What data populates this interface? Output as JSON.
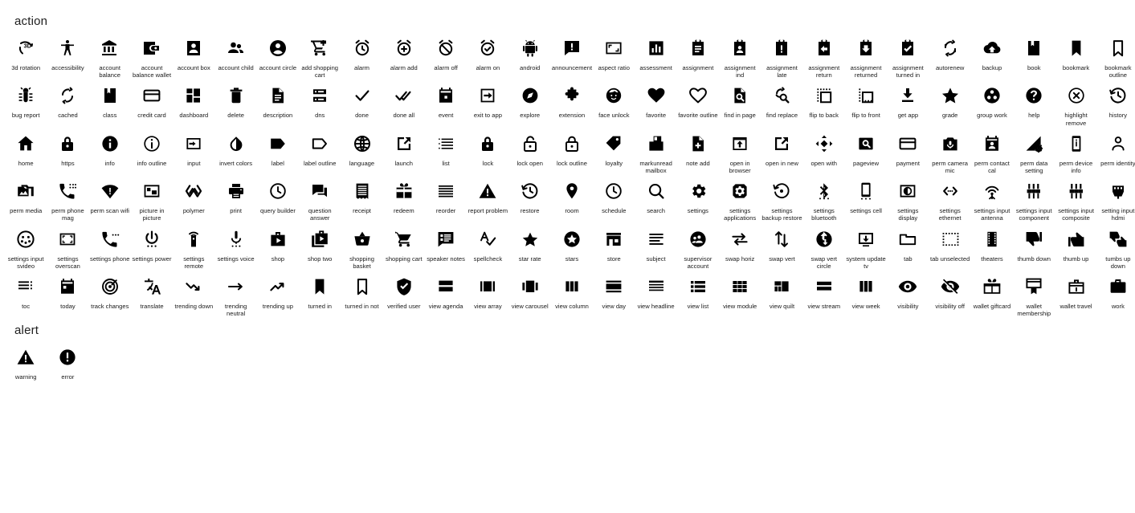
{
  "page": {
    "background": "#ffffff",
    "icon_color": "#000000",
    "label_color": "#1a1a1a"
  },
  "sections": [
    {
      "id": "action",
      "title": "action",
      "icons": [
        {
          "name": "3d-rotation-icon",
          "label": "3d rotation"
        },
        {
          "name": "accessibility-icon",
          "label": "accessibility"
        },
        {
          "name": "account-balance-icon",
          "label": "account balance"
        },
        {
          "name": "account-balance-wallet-icon",
          "label": "account balance wallet"
        },
        {
          "name": "account-box-icon",
          "label": "account box"
        },
        {
          "name": "account-child-icon",
          "label": "account child"
        },
        {
          "name": "account-circle-icon",
          "label": "account circle"
        },
        {
          "name": "add-shopping-cart-icon",
          "label": "add shopping cart"
        },
        {
          "name": "alarm-icon",
          "label": "alarm"
        },
        {
          "name": "alarm-add-icon",
          "label": "alarm add"
        },
        {
          "name": "alarm-off-icon",
          "label": "alarm off"
        },
        {
          "name": "alarm-on-icon",
          "label": "alarm on"
        },
        {
          "name": "android-icon",
          "label": "android"
        },
        {
          "name": "announcement-icon",
          "label": "announcement"
        },
        {
          "name": "aspect-ratio-icon",
          "label": "aspect ratio"
        },
        {
          "name": "assessment-icon",
          "label": "assessment"
        },
        {
          "name": "assignment-icon",
          "label": "assignment"
        },
        {
          "name": "assignment-ind-icon",
          "label": "assignment ind"
        },
        {
          "name": "assignment-late-icon",
          "label": "assignment late"
        },
        {
          "name": "assignment-return-icon",
          "label": "assignment return"
        },
        {
          "name": "assignment-returned-icon",
          "label": "assignment returned"
        },
        {
          "name": "assignment-turned-in-icon",
          "label": "assignment turned in"
        },
        {
          "name": "autorenew-icon",
          "label": "autorenew"
        },
        {
          "name": "backup-icon",
          "label": "backup"
        },
        {
          "name": "book-icon",
          "label": "book"
        },
        {
          "name": "bookmark-icon",
          "label": "bookmark"
        },
        {
          "name": "bookmark-outline-icon",
          "label": "bookmark outline"
        },
        {
          "name": "bug-report-icon",
          "label": "bug report"
        },
        {
          "name": "cached-icon",
          "label": "cached"
        },
        {
          "name": "class-icon",
          "label": "class"
        },
        {
          "name": "credit-card-icon",
          "label": "credit card"
        },
        {
          "name": "dashboard-icon",
          "label": "dashboard"
        },
        {
          "name": "delete-icon",
          "label": "delete"
        },
        {
          "name": "description-icon",
          "label": "description"
        },
        {
          "name": "dns-icon",
          "label": "dns"
        },
        {
          "name": "done-icon",
          "label": "done"
        },
        {
          "name": "done-all-icon",
          "label": "done all"
        },
        {
          "name": "event-icon",
          "label": "event"
        },
        {
          "name": "exit-to-app-icon",
          "label": "exit to app"
        },
        {
          "name": "explore-icon",
          "label": "explore"
        },
        {
          "name": "extension-icon",
          "label": "extension"
        },
        {
          "name": "face-unlock-icon",
          "label": "face unlock"
        },
        {
          "name": "favorite-icon",
          "label": "favorite"
        },
        {
          "name": "favorite-outline-icon",
          "label": "favorite outline"
        },
        {
          "name": "find-in-page-icon",
          "label": "find in page"
        },
        {
          "name": "find-replace-icon",
          "label": "find replace"
        },
        {
          "name": "flip-to-back-icon",
          "label": "flip to back"
        },
        {
          "name": "flip-to-front-icon",
          "label": "flip to front"
        },
        {
          "name": "get-app-icon",
          "label": "get app"
        },
        {
          "name": "grade-icon",
          "label": "grade"
        },
        {
          "name": "group-work-icon",
          "label": "group work"
        },
        {
          "name": "help-icon",
          "label": "help"
        },
        {
          "name": "highlight-remove-icon",
          "label": "highlight remove"
        },
        {
          "name": "history-icon",
          "label": "history"
        },
        {
          "name": "home-icon",
          "label": "home"
        },
        {
          "name": "https-icon",
          "label": "https"
        },
        {
          "name": "info-icon",
          "label": "info"
        },
        {
          "name": "info-outline-icon",
          "label": "info outline"
        },
        {
          "name": "input-icon",
          "label": "input"
        },
        {
          "name": "invert-colors-icon",
          "label": "invert colors"
        },
        {
          "name": "label-icon",
          "label": "label"
        },
        {
          "name": "label-outline-icon",
          "label": "label outline"
        },
        {
          "name": "language-icon",
          "label": "language"
        },
        {
          "name": "launch-icon",
          "label": "launch"
        },
        {
          "name": "list-icon",
          "label": "list"
        },
        {
          "name": "lock-icon",
          "label": "lock"
        },
        {
          "name": "lock-open-icon",
          "label": "lock open"
        },
        {
          "name": "lock-outline-icon",
          "label": "lock outline"
        },
        {
          "name": "loyalty-icon",
          "label": "loyalty"
        },
        {
          "name": "markunread-mailbox-icon",
          "label": "markunread mailbox"
        },
        {
          "name": "note-add-icon",
          "label": "note add"
        },
        {
          "name": "open-in-browser-icon",
          "label": "open in browser"
        },
        {
          "name": "open-in-new-icon",
          "label": "open in new"
        },
        {
          "name": "open-with-icon",
          "label": "open with"
        },
        {
          "name": "pageview-icon",
          "label": "pageview"
        },
        {
          "name": "payment-icon",
          "label": "payment"
        },
        {
          "name": "perm-camera-mic-icon",
          "label": "perm camera mic"
        },
        {
          "name": "perm-contact-cal-icon",
          "label": "perm contact cal"
        },
        {
          "name": "perm-data-setting-icon",
          "label": "perm data setting"
        },
        {
          "name": "perm-device-info-icon",
          "label": "perm device info"
        },
        {
          "name": "perm-identity-icon",
          "label": "perm identity"
        },
        {
          "name": "perm-media-icon",
          "label": "perm media"
        },
        {
          "name": "perm-phone-mag-icon",
          "label": "perm phone mag"
        },
        {
          "name": "perm-scan-wifi-icon",
          "label": "perm scan wifi"
        },
        {
          "name": "picture-in-picture-icon",
          "label": "picture in picture"
        },
        {
          "name": "polymer-icon",
          "label": "polymer"
        },
        {
          "name": "print-icon",
          "label": "print"
        },
        {
          "name": "query-builder-icon",
          "label": "query builder"
        },
        {
          "name": "question-answer-icon",
          "label": "question answer"
        },
        {
          "name": "receipt-icon",
          "label": "receipt"
        },
        {
          "name": "redeem-icon",
          "label": "redeem"
        },
        {
          "name": "reorder-icon",
          "label": "reorder"
        },
        {
          "name": "report-problem-icon",
          "label": "report problem"
        },
        {
          "name": "restore-icon",
          "label": "restore"
        },
        {
          "name": "room-icon",
          "label": "room"
        },
        {
          "name": "schedule-icon",
          "label": "schedule"
        },
        {
          "name": "search-icon",
          "label": "search"
        },
        {
          "name": "settings-icon",
          "label": "settings"
        },
        {
          "name": "settings-applications-icon",
          "label": "settings applications"
        },
        {
          "name": "settings-backup-restore-icon",
          "label": "settings backup restore"
        },
        {
          "name": "settings-bluetooth-icon",
          "label": "settings bluetooth"
        },
        {
          "name": "settings-cell-icon",
          "label": "settings cell"
        },
        {
          "name": "settings-display-icon",
          "label": "settings display"
        },
        {
          "name": "settings-ethernet-icon",
          "label": "settings ethernet"
        },
        {
          "name": "settings-input-antenna-icon",
          "label": "settings input antenna"
        },
        {
          "name": "settings-input-component-icon",
          "label": "settings input component"
        },
        {
          "name": "settings-input-composite-icon",
          "label": "settings input composite"
        },
        {
          "name": "setting-input-hdmi-icon",
          "label": "setting input hdmi"
        },
        {
          "name": "settings-input-svideo-icon",
          "label": "settings input svideo"
        },
        {
          "name": "settings-overscan-icon",
          "label": "settings overscan"
        },
        {
          "name": "settings-phone-icon",
          "label": "settings phone"
        },
        {
          "name": "settings-power-icon",
          "label": "settings power"
        },
        {
          "name": "settings-remote-icon",
          "label": "settings remote"
        },
        {
          "name": "settings-voice-icon",
          "label": "settings voice"
        },
        {
          "name": "shop-icon",
          "label": "shop"
        },
        {
          "name": "shop-two-icon",
          "label": "shop two"
        },
        {
          "name": "shopping-basket-icon",
          "label": "shopping basket"
        },
        {
          "name": "shopping-cart-icon",
          "label": "shopping cart"
        },
        {
          "name": "speaker-notes-icon",
          "label": "speaker notes"
        },
        {
          "name": "spellcheck-icon",
          "label": "spellcheck"
        },
        {
          "name": "star-rate-icon",
          "label": "star rate"
        },
        {
          "name": "stars-icon",
          "label": "stars"
        },
        {
          "name": "store-icon",
          "label": "store"
        },
        {
          "name": "subject-icon",
          "label": "subject"
        },
        {
          "name": "supervisor-account-icon",
          "label": "supervisor account"
        },
        {
          "name": "swap-horiz-icon",
          "label": "swap horiz"
        },
        {
          "name": "swap-vert-icon",
          "label": "swap vert"
        },
        {
          "name": "swap-vert-circle-icon",
          "label": "swap vert circle"
        },
        {
          "name": "system-update-tv-icon",
          "label": "system update tv"
        },
        {
          "name": "tab-icon",
          "label": "tab"
        },
        {
          "name": "tab-unselected-icon",
          "label": "tab unselected"
        },
        {
          "name": "theaters-icon",
          "label": "theaters"
        },
        {
          "name": "thumb-down-icon",
          "label": "thumb down"
        },
        {
          "name": "thumb-up-icon",
          "label": "thumb up"
        },
        {
          "name": "tumbs-up-down-icon",
          "label": "tumbs up down"
        },
        {
          "name": "toc-icon",
          "label": "toc"
        },
        {
          "name": "today-icon",
          "label": "today"
        },
        {
          "name": "track-changes-icon",
          "label": "track changes"
        },
        {
          "name": "translate-icon",
          "label": "translate"
        },
        {
          "name": "trending-down-icon",
          "label": "trending down"
        },
        {
          "name": "trending-neutral-icon",
          "label": "trending neutral"
        },
        {
          "name": "trending-up-icon",
          "label": "trending up"
        },
        {
          "name": "turned-in-icon",
          "label": "turned in"
        },
        {
          "name": "turned-in-not-icon",
          "label": "turned in not"
        },
        {
          "name": "verified-user-icon",
          "label": "verified user"
        },
        {
          "name": "view-agenda-icon",
          "label": "view agenda"
        },
        {
          "name": "view-array-icon",
          "label": "view array"
        },
        {
          "name": "view-carousel-icon",
          "label": "view carousel"
        },
        {
          "name": "view-column-icon",
          "label": "view column"
        },
        {
          "name": "view-day-icon",
          "label": "view day"
        },
        {
          "name": "view-headline-icon",
          "label": "view headline"
        },
        {
          "name": "view-list-icon",
          "label": "view list"
        },
        {
          "name": "view-module-icon",
          "label": "view module"
        },
        {
          "name": "view-quilt-icon",
          "label": "view quilt"
        },
        {
          "name": "view-stream-icon",
          "label": "view stream"
        },
        {
          "name": "view-week-icon",
          "label": "view week"
        },
        {
          "name": "visibility-icon",
          "label": "visibility"
        },
        {
          "name": "visibility-off-icon",
          "label": "visibility off"
        },
        {
          "name": "wallet-giftcard-icon",
          "label": "wallet giftcard"
        },
        {
          "name": "wallet-membership-icon",
          "label": "wallet membership"
        },
        {
          "name": "wallet-travel-icon",
          "label": "wallet travel"
        },
        {
          "name": "work-icon",
          "label": "work"
        }
      ]
    },
    {
      "id": "alert",
      "title": "alert",
      "icons": [
        {
          "name": "warning-icon",
          "label": "warning"
        },
        {
          "name": "error-icon",
          "label": "error"
        }
      ]
    }
  ]
}
